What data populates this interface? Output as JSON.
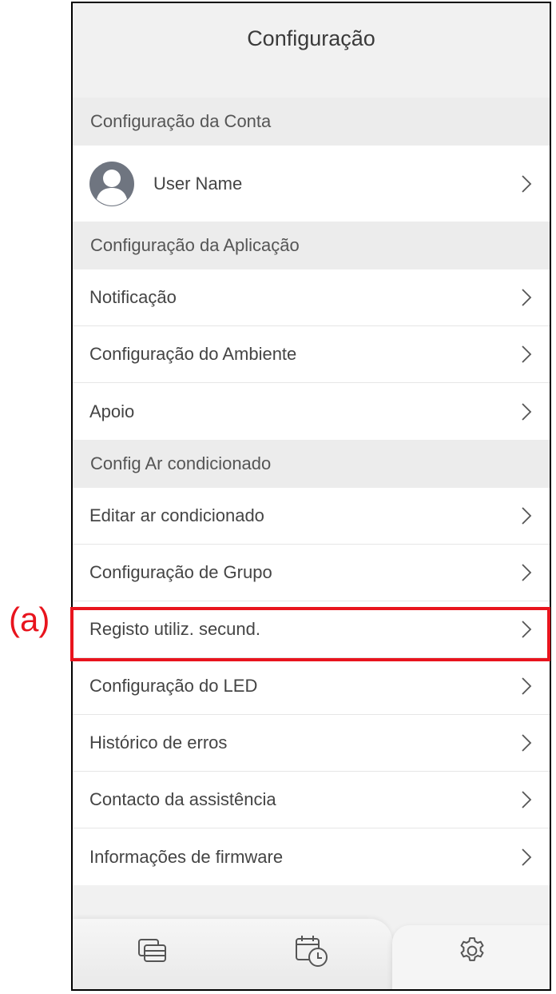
{
  "header": {
    "title": "Configuração"
  },
  "sections": {
    "account": {
      "title": "Configuração da Conta",
      "user_name": "User Name"
    },
    "app": {
      "title": "Configuração da Aplicação",
      "items": [
        "Notificação",
        "Configuração do Ambiente",
        "Apoio"
      ]
    },
    "ac": {
      "title": "Config Ar condicionado",
      "items": [
        "Editar ar condicionado",
        "Configuração de Grupo",
        "Registo utiliz. secund.",
        "Configuração do LED",
        "Histórico de erros",
        "Contacto da assistência",
        "Informações de firmware"
      ]
    }
  },
  "annotation": {
    "marker": "(a)",
    "color": "#e8141d",
    "highlighted_item": "Registo utiliz. secund."
  },
  "tabbar": {
    "tabs": [
      "devices-icon",
      "schedule-icon",
      "settings-icon"
    ],
    "active": "settings-icon"
  }
}
